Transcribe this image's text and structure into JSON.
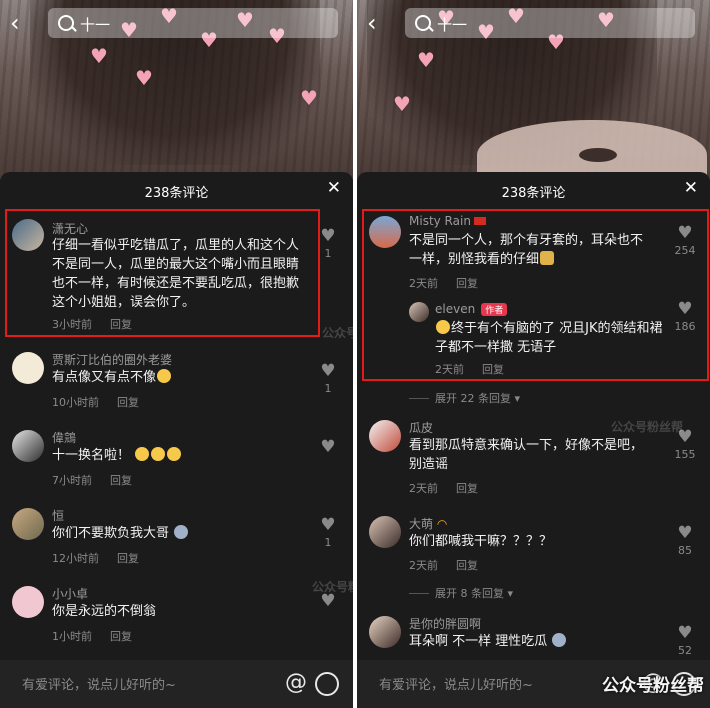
{
  "search": {
    "placeholder": "十一"
  },
  "left": {
    "title": "238条评论",
    "comments": [
      {
        "name": "潇无心",
        "text": "仔细一看似乎吃错瓜了，瓜里的人和这个人不是同一人，瓜里的最大这个嘴小而且眼睛也不一样，有时候还是不要乱吃瓜，很抱歉这个小姐姐，误会你了。",
        "time": "3小时前",
        "reply": "回复",
        "likes": "1"
      },
      {
        "name": "贾斯汀比伯的圈外老婆",
        "text": "有点像又有点不像",
        "time": "10小时前",
        "reply": "回复",
        "likes": "1"
      },
      {
        "name": "偉鵍",
        "text": "十一换名啦！",
        "time": "7小时前",
        "reply": "回复",
        "likes": ""
      },
      {
        "name": "恒",
        "text": "你们不要欺负我大哥",
        "time": "12小时前",
        "reply": "回复",
        "likes": "1"
      },
      {
        "name": "小小卓",
        "text": "你是永远的不倒翁",
        "time": "1小时前",
        "reply": "回复",
        "likes": ""
      }
    ]
  },
  "right": {
    "title": "238条评论",
    "comments": [
      {
        "name": "Misty Rain",
        "text": "不是同一个人，那个有牙套的，耳朵也不一样，别怪我看的仔细",
        "time": "2天前",
        "reply": "回复",
        "likes": "254"
      },
      {
        "name": "eleven",
        "tag": "作者",
        "text": "终于有个有脑的了 况且JK的领结和裙子都不一样撒 无语子",
        "time": "2天前",
        "reply": "回复",
        "likes": "186"
      },
      {
        "name": "瓜皮",
        "text": "看到那瓜特意来确认一下，好像不是吧，别造谣",
        "time": "2天前",
        "reply": "回复",
        "likes": "155"
      },
      {
        "name": "大萌",
        "text": "你们都喊我干嘛？？？？",
        "time": "2天前",
        "reply": "回复",
        "likes": "85"
      },
      {
        "name": "是你的胖圆啊",
        "text": "耳朵啊 不一样 理性吃瓜",
        "time": "",
        "reply": "",
        "likes": "52"
      }
    ],
    "expand1": "展开 22 条回复",
    "expand2": "展开 8 条回复"
  },
  "input": {
    "placeholder": "有爱评论，说点儿好听的~"
  },
  "watermark": "公众号粉丝帮",
  "brand": "公众号粉丝帮",
  "colors": {
    "highlight_border": "#e21b1b",
    "author_tag": "#e8364f",
    "heart": "#f2a3b5"
  }
}
